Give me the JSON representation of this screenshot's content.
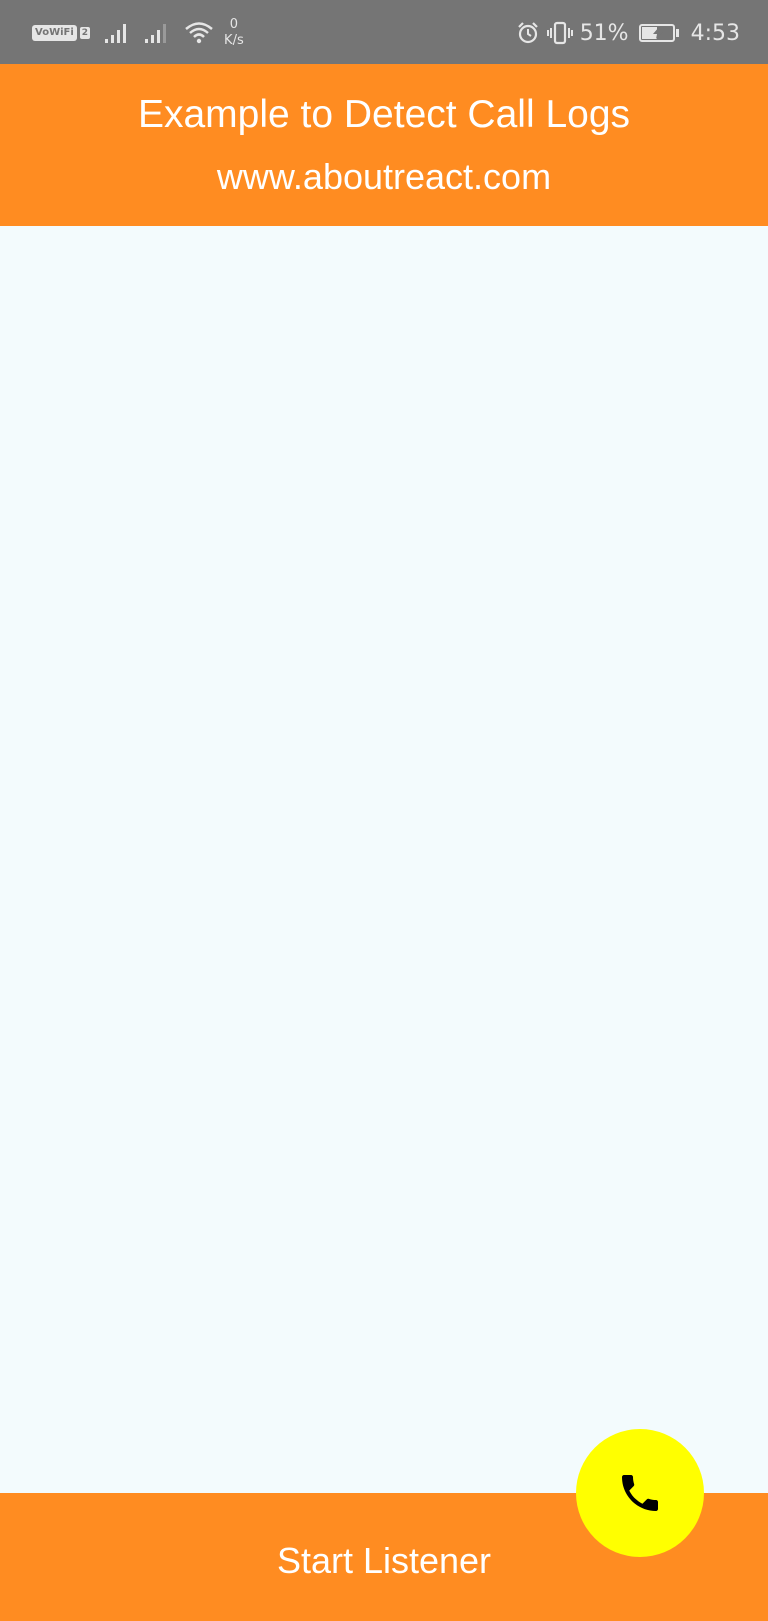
{
  "status_bar": {
    "vowifi_label": "VoWiFi",
    "vowifi_sim": "2",
    "net_speed_value": "0",
    "net_speed_unit": "K/s",
    "battery_percent": "51%",
    "battery_level": 0.51,
    "time": "4:53"
  },
  "header": {
    "title": "Example to Detect Call Logs",
    "subtitle": "www.aboutreact.com"
  },
  "footer": {
    "button_label": "Start Listener"
  },
  "fab": {
    "icon": "phone-icon"
  },
  "colors": {
    "accent": "#ff8c21",
    "fab": "#ffff00",
    "background": "#f3fbfd",
    "status_bar": "#757575"
  }
}
